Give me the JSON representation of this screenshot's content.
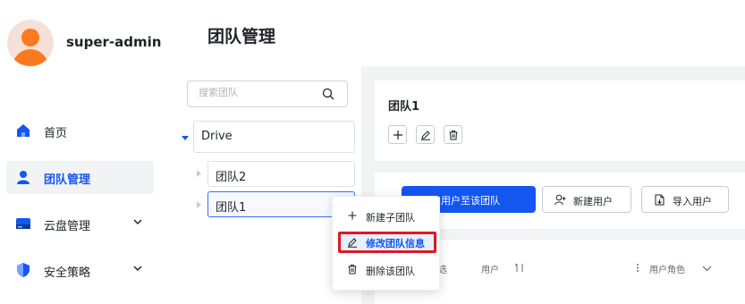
{
  "user": {
    "name": "super-admin"
  },
  "sidebar": {
    "items": [
      {
        "label": "首页",
        "icon": "home-icon"
      },
      {
        "label": "团队管理",
        "icon": "user-icon",
        "active": true
      },
      {
        "label": "云盘管理",
        "icon": "drive-icon",
        "expandable": true
      },
      {
        "label": "安全策略",
        "icon": "shield-icon",
        "expandable": true
      }
    ]
  },
  "page": {
    "title": "团队管理"
  },
  "tree": {
    "search_placeholder": "搜索团队",
    "root": "Drive",
    "children": [
      "团队2",
      "团队1"
    ]
  },
  "detail": {
    "team_name": "团队1",
    "actions": {
      "add_user_to_team": "添加用户至该团队",
      "new_user": "新建用户",
      "import_users": "导入用户"
    },
    "table_headers": {
      "select": "选",
      "user": "用户",
      "role": "用户角色"
    }
  },
  "context_menu": {
    "items": [
      "新建子团队",
      "修改团队信息",
      "删除该团队"
    ],
    "highlighted": "修改团队信息"
  },
  "colors": {
    "accent": "#1456f0",
    "highlight_border": "#e0171f",
    "avatar": "#fb7a1e"
  }
}
